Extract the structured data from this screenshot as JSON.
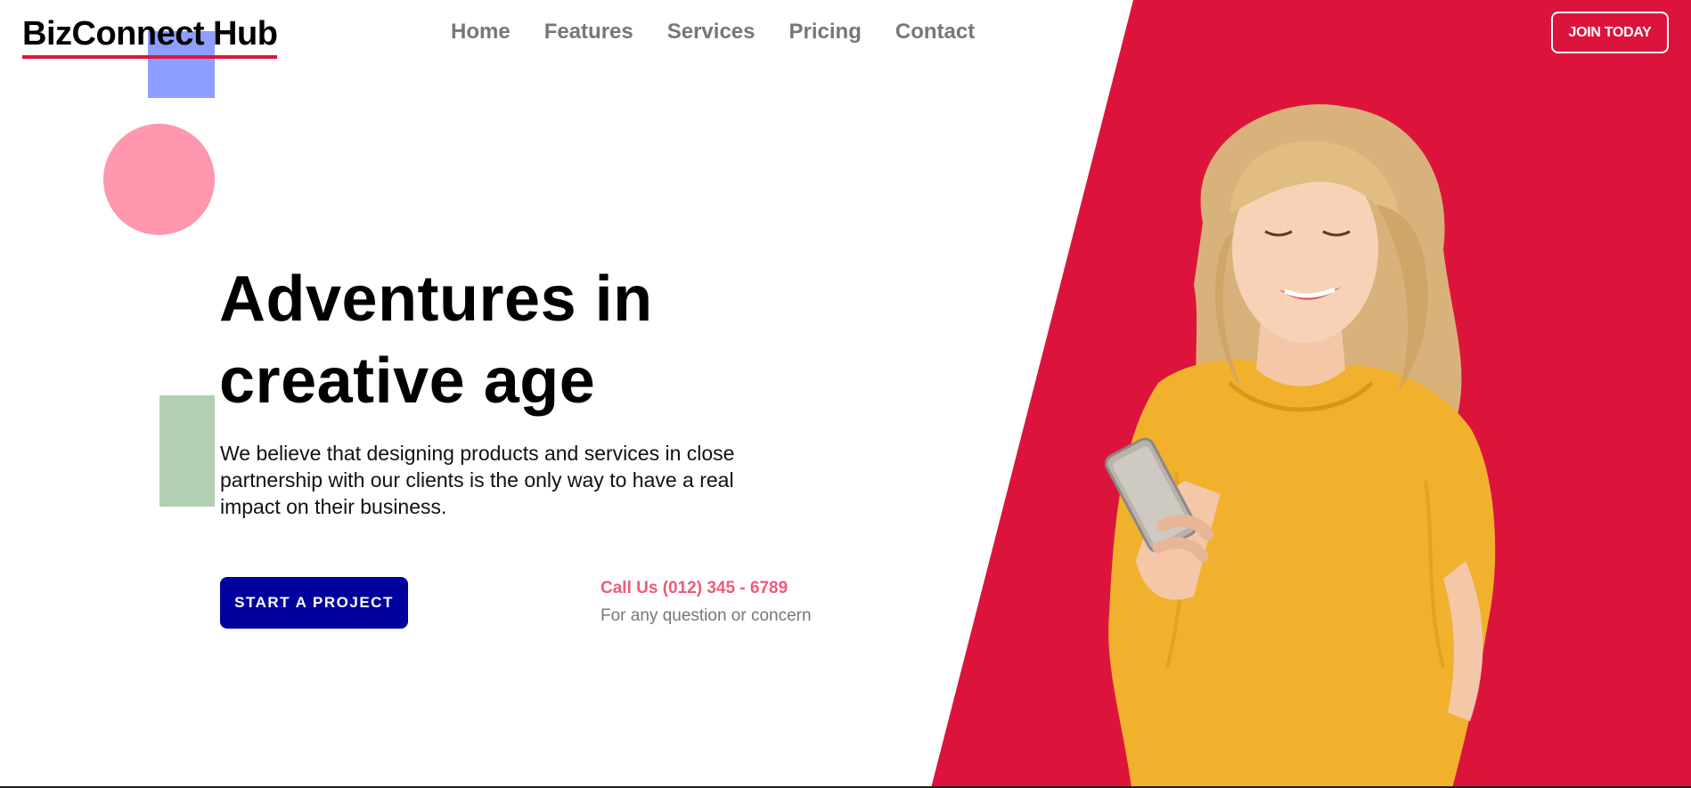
{
  "header": {
    "logo": "BizConnect Hub",
    "nav": [
      "Home",
      "Features",
      "Services",
      "Pricing",
      "Contact"
    ],
    "cta": "JOIN TODAY"
  },
  "hero": {
    "title_line1": "Adventures in",
    "title_line2": "creative age",
    "description": "We believe that designing products and services in close partnership with our clients is the only way to have a real impact on their business.",
    "primary_button": "START A PROJECT",
    "call_label": "Call Us (012) 345 - 6789",
    "call_sub": "For any question or concern"
  },
  "colors": {
    "accent_red": "#dc143c",
    "button_blue": "#00009c",
    "call_pink": "#f05a78",
    "deco_blue": "#8c9eff",
    "deco_pink": "#ff97ae",
    "deco_green": "#b3cfb1",
    "sweater_yellow": "#f2b12c"
  },
  "icons": {
    "hero_image": "woman-with-phone-photo"
  }
}
